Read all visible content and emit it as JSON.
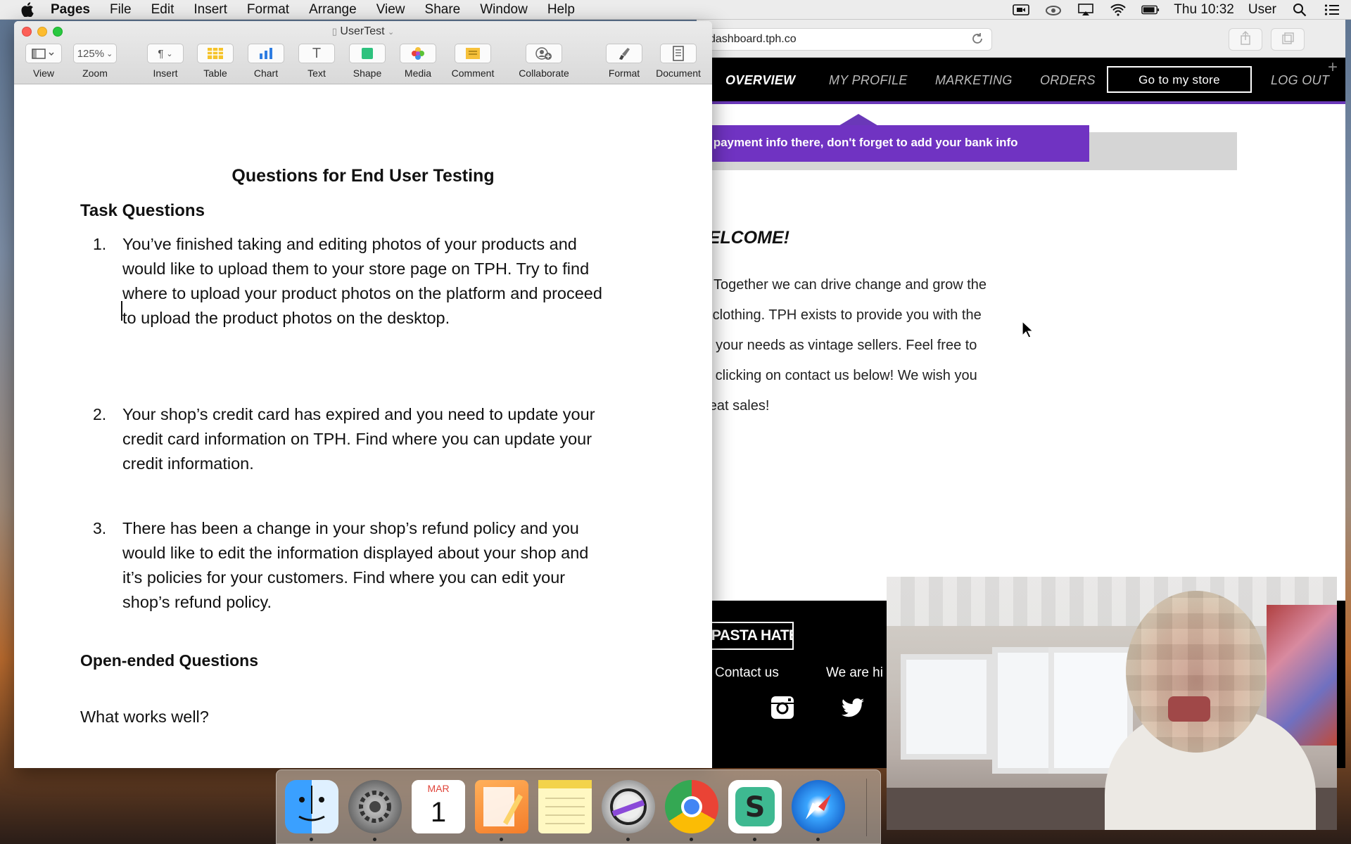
{
  "menubar": {
    "app_name": "Pages",
    "menus": [
      "File",
      "Edit",
      "Insert",
      "Format",
      "Arrange",
      "View",
      "Share",
      "Window",
      "Help"
    ],
    "clock": "Thu 10:32",
    "user": "User"
  },
  "pages_window": {
    "title": "UserTest",
    "toolbar": {
      "view": "View",
      "zoom_value": "125%",
      "zoom": "Zoom",
      "insert": "Insert",
      "table": "Table",
      "chart": "Chart",
      "text": "Text",
      "shape": "Shape",
      "media": "Media",
      "comment": "Comment",
      "collaborate": "Collaborate",
      "format": "Format",
      "document": "Document"
    },
    "document": {
      "heading": "Questions for End User Testing",
      "task_heading": "Task Questions",
      "questions": [
        {
          "num": "1.",
          "lines": [
            "You’ve finished taking and editing photos of your products and",
            "would like to upload them to your store page on TPH. Try to find",
            "where to upload your product photos on the platform and proceed",
            "to upload the product photos on the desktop."
          ]
        },
        {
          "num": "2.",
          "lines": [
            "Your shop’s credit card has expired and you need to update your",
            "credit card information on TPH. Find where you can update your",
            "credit information."
          ]
        },
        {
          "num": "3.",
          "lines": [
            "There has been a change in your shop’s refund policy and you",
            "would like to edit the information displayed about your shop and",
            "it’s policies for your customers. Find where you can edit your",
            "shop’s refund policy."
          ]
        }
      ],
      "open_heading": "Open-ended Questions",
      "open_q1": "What works well?"
    }
  },
  "browser": {
    "url": "dashboard.tph.co",
    "nav": {
      "overview": "OVERVIEW",
      "my_profile": "MY PROFILE",
      "marketing": "MARKETING",
      "orders": "ORDERS",
      "store_button": "Go to my store",
      "logout": "LOG OUT"
    },
    "banner": "ur payment info there, don't forget to add your bank info",
    "welcome_title": "VELCOME!",
    "welcome_lines": [
      "Together we can drive change and grow the",
      "e clothing. TPH exists to provide you with the",
      "ts your needs as vintage sellers. Feel free to",
      "by clicking on contact us below! We wish you",
      "great sales!"
    ],
    "footer": {
      "logo": "E PASTA HATERS",
      "contact": "Contact us",
      "hiring": "We are hi"
    }
  },
  "dock": {
    "calendar_month": "MAR",
    "calendar_day": "1"
  },
  "colors": {
    "accent_purple": "#7033c2",
    "nav_black": "#000000"
  }
}
